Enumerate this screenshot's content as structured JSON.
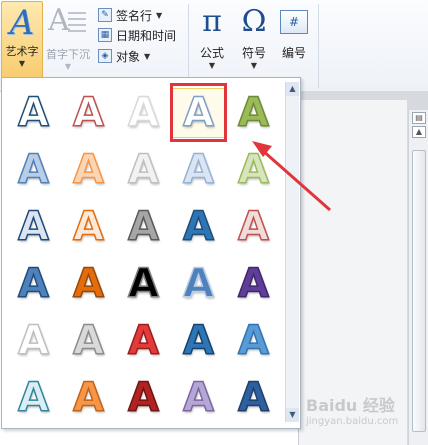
{
  "ribbon": {
    "wordart_label": "艺术字",
    "dropcap_label": "首字下沉",
    "signature_label": "签名行",
    "datetime_label": "日期和时间",
    "object_label": "对象",
    "equation_glyph": "π",
    "equation_label": "公式",
    "symbol_glyph": "Ω",
    "symbol_label": "符号",
    "number_glyph": "#",
    "number_label": "编号"
  },
  "gallery": {
    "glyph": "A",
    "selected_index": 3,
    "styles": [
      {
        "fill": "#ffffff",
        "stroke": "#1f4e79"
      },
      {
        "fill": "#ffffff",
        "stroke": "#c0504d"
      },
      {
        "fill": "#ffffff",
        "stroke": "#d9d9d9"
      },
      {
        "fill": "#ffffff",
        "stroke": "#7f9fc8"
      },
      {
        "fill": "#9bbb59",
        "stroke": "#6d8a3a"
      },
      {
        "fill": "#b9cde5",
        "stroke": "#4f81bd"
      },
      {
        "fill": "#fcd5b4",
        "stroke": "#f79646"
      },
      {
        "fill": "#f2f2f2",
        "stroke": "#bfbfbf"
      },
      {
        "fill": "#dbe5f1",
        "stroke": "#93b3d7"
      },
      {
        "fill": "#d7e4bd",
        "stroke": "#9bbb59"
      },
      {
        "fill": "#dbe5f1",
        "stroke": "#1f497d"
      },
      {
        "fill": "#fde9d9",
        "stroke": "#e46c0a"
      },
      {
        "fill": "#a6a6a6",
        "stroke": "#595959"
      },
      {
        "fill": "#2e75b6",
        "stroke": "#1f4e79"
      },
      {
        "fill": "#f2dcdb",
        "stroke": "#c0504d"
      },
      {
        "fill": "#4f81bd",
        "stroke": "#1f4e79"
      },
      {
        "fill": "#e46c0a",
        "stroke": "#974806"
      },
      {
        "fill": "#000000",
        "stroke": "#7f7f7f"
      },
      {
        "fill": "#4f81bd",
        "stroke": "#b9cde5"
      },
      {
        "fill": "#5f3e9b",
        "stroke": "#3f2768"
      },
      {
        "fill": "#ffffff",
        "stroke": "#bfbfbf"
      },
      {
        "fill": "#d9d9d9",
        "stroke": "#8c8c8c"
      },
      {
        "fill": "#e23b3b",
        "stroke": "#9c1c1c"
      },
      {
        "fill": "#2e75b6",
        "stroke": "#16426e"
      },
      {
        "fill": "#5b9bd5",
        "stroke": "#2e75b6"
      },
      {
        "fill": "#daeef3",
        "stroke": "#31859c"
      },
      {
        "fill": "#f79646",
        "stroke": "#c0631a"
      },
      {
        "fill": "#b22222",
        "stroke": "#6e1414"
      },
      {
        "fill": "#b4a7d6",
        "stroke": "#8064a2"
      },
      {
        "fill": "#2e5f9e",
        "stroke": "#1f3f6b"
      }
    ]
  },
  "document": {
    "watermark_title": "Baidu 经验",
    "watermark_url": "jingyan.baidu.com"
  }
}
